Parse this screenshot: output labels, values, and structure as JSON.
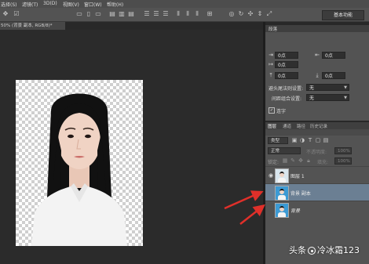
{
  "menu": {
    "items": [
      "选择(S)",
      "滤镜(T)",
      "3D(D)",
      "视图(V)",
      "窗口(W)",
      "帮助(H)"
    ]
  },
  "options_bar": {
    "workspace_label": "基本功能"
  },
  "document": {
    "tab_label": "50% (背景 副本, RGB/8)*"
  },
  "character_panel": {
    "title": "段落",
    "indent_left_value": "0点",
    "indent_right_value": "0点",
    "indent_first_value": "0点",
    "space_before_value": "0点",
    "space_after_value": "0点",
    "punct_label": "避头尾法则设置:",
    "punct_value": "无",
    "spacing_label": "间距组合设置:",
    "spacing_value": "无",
    "hyphen_label": "连字",
    "hyphen_checked": true
  },
  "layers_panel": {
    "tabs": [
      "图层",
      "通道",
      "路径",
      "历史记录"
    ],
    "kind_filter": "类型",
    "blend_mode": "正常",
    "opacity_label": "不透明度:",
    "opacity_value": "100%",
    "lock_label": "锁定:",
    "fill_label": "填充:",
    "fill_value": "100%",
    "layers": [
      {
        "name": "图层 1",
        "visible": true,
        "selected": false,
        "thumb": "portrait-white"
      },
      {
        "name": "背景 副本",
        "visible": false,
        "selected": true,
        "thumb": "portrait-blue"
      },
      {
        "name": "背景",
        "visible": false,
        "selected": false,
        "thumb": "portrait-blue"
      }
    ]
  },
  "annotation": {
    "arrow_color": "#e0302a"
  },
  "watermark": {
    "text_prefix": "头条",
    "text_user": "冷冰霜123"
  },
  "colors": {
    "selection": "#6b7f93",
    "panel": "#535353",
    "canvas_bg": "#2b2b2b"
  }
}
